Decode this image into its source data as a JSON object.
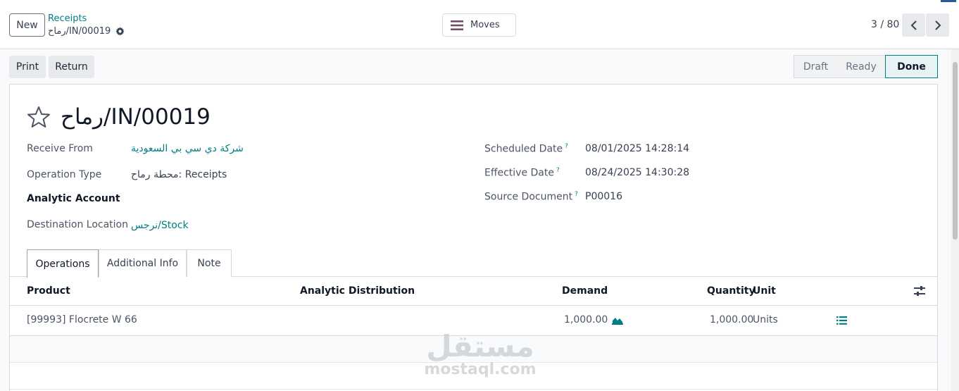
{
  "topbar": {
    "new_label": "New",
    "breadcrumb_parent": "Receipts",
    "breadcrumb_current": "رماح/IN/00019",
    "moves_label": "Moves",
    "pager_value": "3 / 80"
  },
  "actions": {
    "print_label": "Print",
    "return_label": "Return"
  },
  "status": {
    "stages": [
      "Draft",
      "Ready",
      "Done"
    ],
    "current": "Done"
  },
  "record": {
    "title": "رماح/IN/00019",
    "fields_left": {
      "receive_from_label": "Receive From",
      "receive_from_value": "شركة دي سي بي السعودية",
      "operation_type_label": "Operation Type",
      "operation_type_value": "محطة رماح: Receipts",
      "analytic_account_label": "Analytic Account",
      "destination_location_label": "Destination Location",
      "destination_location_value": "نرجس/Stock"
    },
    "fields_right": {
      "scheduled_date_label": "Scheduled Date",
      "scheduled_date_value": "08/01/2025 14:28:14",
      "effective_date_label": "Effective Date",
      "effective_date_value": "08/24/2025 14:30:28",
      "source_document_label": "Source Document",
      "source_document_value": "P00016",
      "help_mark": "?"
    }
  },
  "tabs": [
    "Operations",
    "Additional Info",
    "Note"
  ],
  "active_tab": "Operations",
  "operations": {
    "columns": [
      "Product",
      "Analytic Distribution",
      "Demand",
      "Quantity",
      "Unit"
    ],
    "rows": [
      {
        "product": "[99993] Flocrete W 66",
        "analytic_distribution": "",
        "demand": "1,000.00",
        "quantity": "1,000.00",
        "unit": "Units"
      }
    ]
  },
  "watermark": {
    "arabic": "مستقل",
    "latin": "mostaql.com"
  },
  "colors": {
    "accent": "#017e84",
    "brand_purple": "#714b67",
    "border": "#d8dadd"
  },
  "icons": {
    "settings": "gear-icon",
    "moves": "hamburger-icon",
    "prev": "chevron-left-icon",
    "next": "chevron-right-icon",
    "favorite": "star-icon",
    "forecast": "area-chart-icon",
    "details": "list-icon",
    "optional_columns": "sliders-icon"
  }
}
